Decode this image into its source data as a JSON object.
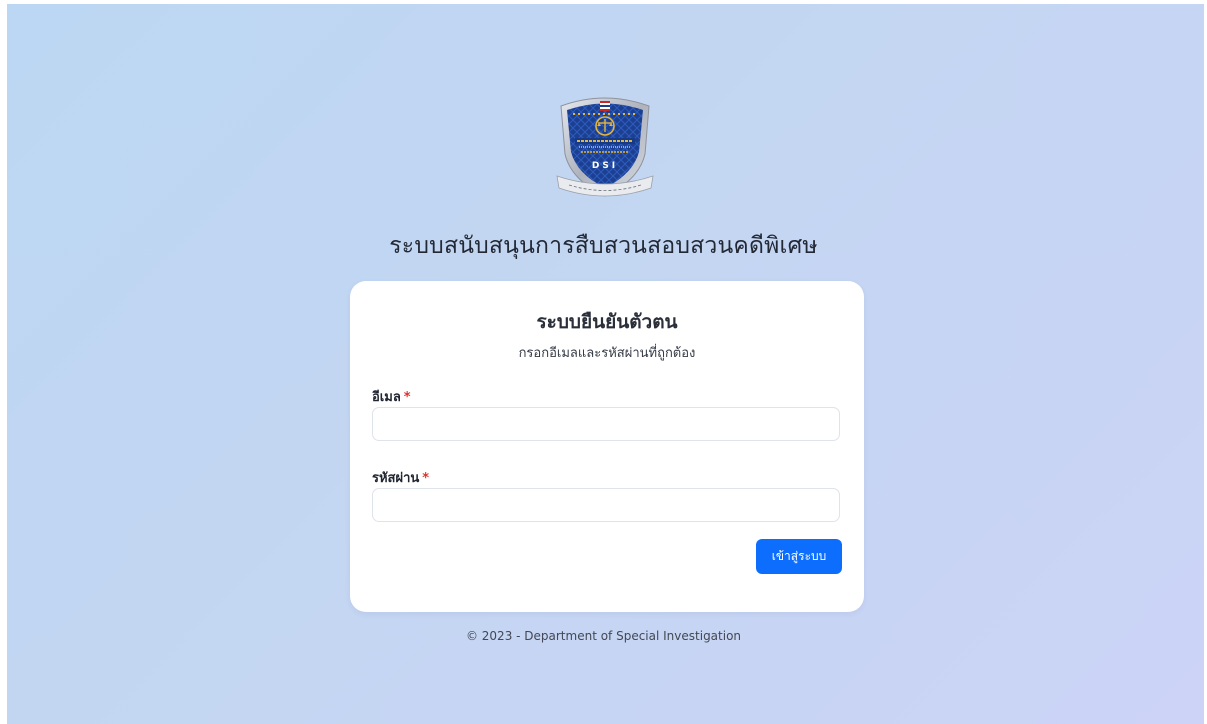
{
  "branding": {
    "logo_text_thai": "กรมสอบสวนคดีพิเศษ",
    "logo_text_english": "DEPARTMENT OF SPECIAL INVESTIGATION",
    "logo_text_ministry": "กระทรวงยุติธรรม",
    "logo_abbreviation": "D S I",
    "logo_motto": "ยึดหลักนิติธรรม ตั้งมั่นในคุณธรรม",
    "logo_colors": {
      "shield_blue": "#1c3f8f",
      "shield_frame": "#c9ccd3",
      "emblem_gold": "#e3b53a"
    }
  },
  "app_title": "ระบบสนับสนุนการสืบสวนสอบสวนคดีพิเศษ",
  "login_card": {
    "title": "ระบบยืนยันตัวตน",
    "subtitle": "กรอกอีเมลและรหัสผ่านที่ถูกต้อง",
    "email": {
      "label": "อีเมล",
      "required_mark": "*",
      "value": "",
      "placeholder": ""
    },
    "password": {
      "label": "รหัสผ่าน",
      "required_mark": "*",
      "value": "",
      "placeholder": ""
    },
    "submit_label": "เข้าสู่ระบบ"
  },
  "footer": "© 2023 - Department of Special Investigation",
  "colors": {
    "primary": "#0d6efd",
    "required": "#d9342b",
    "background_start": "#bcd7f3",
    "background_end": "#ccd3f6"
  }
}
